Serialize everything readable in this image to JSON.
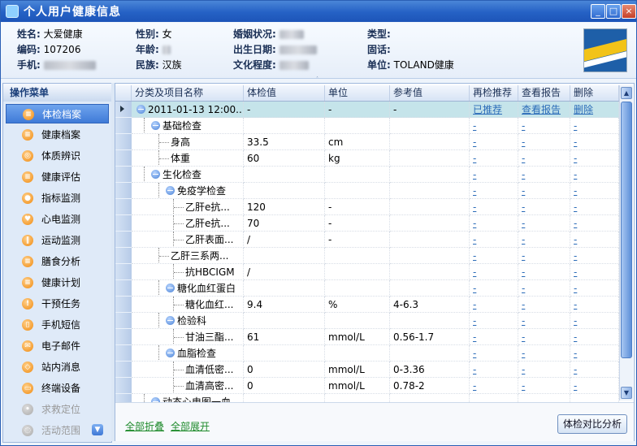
{
  "window": {
    "title": "个人用户健康信息",
    "buttons": [
      "_",
      "□",
      "×"
    ]
  },
  "info": {
    "name_label": "姓名:",
    "name": "大爱健康",
    "gender_label": "性别:",
    "gender": "女",
    "marital_label": "婚姻状况:",
    "type_label": "类型:",
    "code_label": "编码:",
    "code": "107206",
    "age_label": "年龄:",
    "birth_label": "出生日期:",
    "phone_fixed_label": "固话:",
    "mobile_label": "手机:",
    "ethnic_label": "民族:",
    "ethnic": "汉族",
    "edu_label": "文化程度:",
    "unit_label": "单位:",
    "unit": "TOLAND健康"
  },
  "sidebar": {
    "title": "操作菜单",
    "items": [
      {
        "label": "体检档案",
        "icon": "document-icon",
        "selected": true
      },
      {
        "label": "健康档案",
        "icon": "list-icon"
      },
      {
        "label": "体质辨识",
        "icon": "globe-icon"
      },
      {
        "label": "健康评估",
        "icon": "list-icon"
      },
      {
        "label": "指标监测",
        "icon": "drop-icon"
      },
      {
        "label": "心电监测",
        "icon": "heart-icon"
      },
      {
        "label": "运动监测",
        "icon": "activity-icon"
      },
      {
        "label": "膳食分析",
        "icon": "food-icon"
      },
      {
        "label": "健康计划",
        "icon": "list-icon"
      },
      {
        "label": "干预任务",
        "icon": "bell-icon"
      },
      {
        "label": "手机短信",
        "icon": "phone-icon"
      },
      {
        "label": "电子邮件",
        "icon": "mail-icon"
      },
      {
        "label": "站内消息",
        "icon": "chat-icon"
      },
      {
        "label": "终端设备",
        "icon": "device-icon"
      },
      {
        "label": "求救定位",
        "icon": "pin-icon",
        "disabled": true
      },
      {
        "label": "活动范围",
        "icon": "area-icon",
        "disabled": true
      }
    ]
  },
  "grid": {
    "columns": [
      "分类及项目名称",
      "体检值",
      "单位",
      "参考值",
      "再检推荐",
      "查看报告",
      "删除"
    ],
    "rows": [
      {
        "name": "2011-01-13 12:00...",
        "value": "-",
        "unit": "-",
        "ref": "-",
        "recheck": "已推荐",
        "report": "查看报告",
        "del": "删除",
        "level": 0,
        "node": true,
        "selected": true
      },
      {
        "name": "基础检查",
        "value": "",
        "unit": "",
        "ref": "",
        "recheck": "-",
        "report": "-",
        "del": "-",
        "level": 1,
        "node": true
      },
      {
        "name": "身高",
        "value": "33.5",
        "unit": "cm",
        "ref": "",
        "recheck": "-",
        "report": "-",
        "del": "-",
        "level": 2
      },
      {
        "name": "体重",
        "value": "60",
        "unit": "kg",
        "ref": "",
        "recheck": "-",
        "report": "-",
        "del": "-",
        "level": 2
      },
      {
        "name": "生化检查",
        "value": "",
        "unit": "",
        "ref": "",
        "recheck": "-",
        "report": "-",
        "del": "-",
        "level": 1,
        "node": true
      },
      {
        "name": "免疫学检查",
        "value": "",
        "unit": "",
        "ref": "",
        "recheck": "-",
        "report": "-",
        "del": "-",
        "level": 2,
        "node": true
      },
      {
        "name": "乙肝e抗...",
        "value": "120",
        "unit": "-",
        "ref": "",
        "recheck": "-",
        "report": "-",
        "del": "-",
        "level": 3
      },
      {
        "name": "乙肝e抗...",
        "value": "70",
        "unit": "-",
        "ref": "",
        "recheck": "-",
        "report": "-",
        "del": "-",
        "level": 3
      },
      {
        "name": "乙肝表面...",
        "value": "/",
        "unit": "-",
        "ref": "",
        "recheck": "-",
        "report": "-",
        "del": "-",
        "level": 3
      },
      {
        "name": "乙肝三系两...",
        "value": "",
        "unit": "",
        "ref": "",
        "recheck": "-",
        "report": "-",
        "del": "-",
        "level": 2
      },
      {
        "name": "抗HBCIGM",
        "value": "/",
        "unit": "",
        "ref": "",
        "recheck": "-",
        "report": "-",
        "del": "-",
        "level": 3
      },
      {
        "name": "糖化血红蛋白",
        "value": "",
        "unit": "",
        "ref": "",
        "recheck": "-",
        "report": "-",
        "del": "-",
        "level": 2,
        "node": true
      },
      {
        "name": "糖化血红...",
        "value": "9.4",
        "unit": "%",
        "ref": "4-6.3",
        "recheck": "-",
        "report": "-",
        "del": "-",
        "level": 3
      },
      {
        "name": "检验科",
        "value": "",
        "unit": "",
        "ref": "",
        "recheck": "-",
        "report": "-",
        "del": "-",
        "level": 2,
        "node": true
      },
      {
        "name": "甘油三酯...",
        "value": "61",
        "unit": "mmol/L",
        "ref": "0.56-1.7",
        "recheck": "-",
        "report": "-",
        "del": "-",
        "level": 3
      },
      {
        "name": "血脂检查",
        "value": "",
        "unit": "",
        "ref": "",
        "recheck": "-",
        "report": "-",
        "del": "-",
        "level": 2,
        "node": true
      },
      {
        "name": "血清低密...",
        "value": "0",
        "unit": "mmol/L",
        "ref": "0-3.36",
        "recheck": "-",
        "report": "-",
        "del": "-",
        "level": 3
      },
      {
        "name": "血清高密...",
        "value": "0",
        "unit": "mmol/L",
        "ref": "0.78-2",
        "recheck": "-",
        "report": "-",
        "del": "-",
        "level": 3
      },
      {
        "name": "动态心电图一血...",
        "value": "",
        "unit": "",
        "ref": "",
        "recheck": "",
        "report": "",
        "del": "",
        "level": 1,
        "node": true
      }
    ]
  },
  "footer": {
    "collapse_all": "全部折叠",
    "expand_all": "全部展开",
    "compare_button": "体检对比分析"
  }
}
